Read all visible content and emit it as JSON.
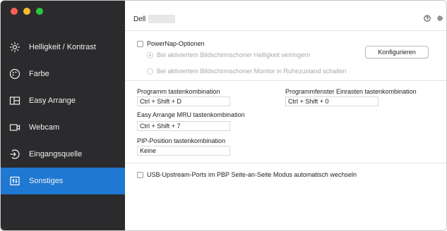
{
  "window": {
    "traffic_colors": [
      "#ff5f57",
      "#febc2e",
      "#28c840"
    ]
  },
  "sidebar": {
    "items": [
      {
        "label": "Helligkeit / Kontrast",
        "icon": "brightness-icon",
        "active": false
      },
      {
        "label": "Farbe",
        "icon": "color-palette-icon",
        "active": false
      },
      {
        "label": "Easy Arrange",
        "icon": "easy-arrange-icon",
        "active": false
      },
      {
        "label": "Webcam",
        "icon": "webcam-icon",
        "active": false
      },
      {
        "label": "Eingangsquelle",
        "icon": "input-source-icon",
        "active": false
      },
      {
        "label": "Sonstiges",
        "icon": "others-icon",
        "active": true
      }
    ]
  },
  "header": {
    "brand": "Dell",
    "help_icon": "help-icon",
    "settings_icon": "gear-icon"
  },
  "powernap": {
    "label": "PowerNap-Optionen",
    "checked": false,
    "option1": "Bei aktiviertem Bildschirmschoner Helligkeit verringern",
    "option2": "Bei aktiviertem Bildschirmschoner Monitor in Ruhezustand schalten",
    "configure_label": "Konfigurieren"
  },
  "shortcuts": {
    "program_label": "Programm tastenkombination",
    "program_value": "Ctrl + Shift + D",
    "snap_label": "Programmfenster Einrasten tastenkombination",
    "snap_value": "Ctrl + Shift + 0",
    "mru_label": "Easy Arrange MRU tastenkombination",
    "mru_value": "Ctrl + Shift + 7",
    "pip_label": "PIP-Position tastenkombination",
    "pip_value": "Keine"
  },
  "usb": {
    "label": "USB-Upstream-Ports im PBP Seite-an-Seite Modus automatisch wechseln",
    "checked": false
  },
  "colors": {
    "sidebar_bg": "#2b2b2d",
    "active": "#1f78d1"
  }
}
